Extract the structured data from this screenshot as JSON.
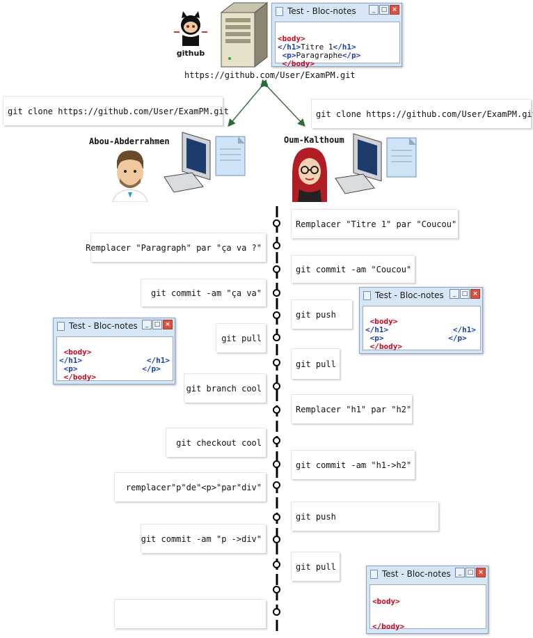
{
  "header": {
    "repo_url": "https://github.com/User/ExamPM.git",
    "github_logo_text": "github"
  },
  "clone": {
    "left": "git clone https://github.com/User/ExamPM.git",
    "right": "git clone https://github.com/User/ExamPM.git"
  },
  "users": {
    "left_name": "Abou-Abderrahmen",
    "right_name": "Oum-Kalthoum"
  },
  "timeline": {
    "right": [
      "Remplacer \"Titre 1\" par \"Coucou\"",
      "git commit -am \"Coucou\"",
      "git push",
      "git pull",
      "Remplacer \"h1\" par \"h2\"",
      "git commit -am \"h1->h2\"",
      "git push",
      "git pull"
    ],
    "left": [
      "Remplacer \"Paragraph\" par \"ça va ?\"",
      "git commit -am \"ça va\"",
      "git pull",
      "git branch cool",
      "git checkout cool",
      "remplacer\"p\"de\"<p>\"par\"div\"",
      "git commit -am \"p ->div\"",
      ""
    ]
  },
  "notepad": {
    "title": "Test - Bloc-notes",
    "win1": [
      "<body>",
      "</h1>",
      "Titre 1",
      "</h1>",
      "<p>",
      "Paragraphe",
      "</p>",
      "</body>"
    ],
    "win2": [
      "<body>",
      "</h1>",
      "</h1>",
      "<p>",
      "</p>",
      "</body>"
    ],
    "win3": [
      "<body>",
      "</h1>",
      "</h1>",
      "<p>",
      "</p>",
      "</body>"
    ],
    "win4": [
      "<body>",
      "</body>"
    ]
  },
  "colors": {
    "tag_red": "#d0021b",
    "tag_blue": "#1a3fb5",
    "arrow": "#2f6b3a"
  }
}
